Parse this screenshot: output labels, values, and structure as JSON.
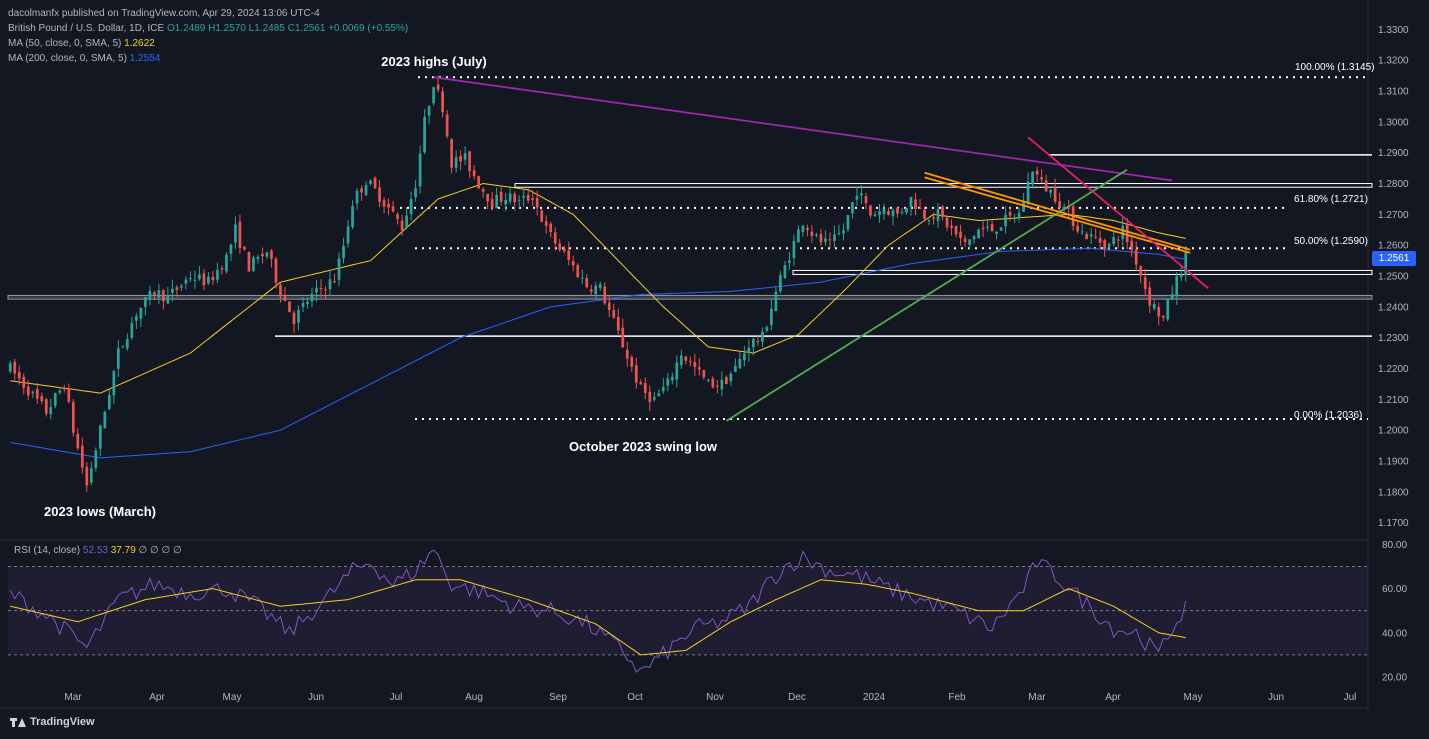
{
  "header": {
    "published": "dacolmanfx published on TradingView.com, Apr 29, 2024 13:06 UTC-4",
    "symbol": "British Pound / U.S. Dollar, 1D, ICE",
    "ohlc": "O1.2489  H1.2570  L1.2485  C1.2561  +0.0069 (+0.55%)",
    "ma50_label": "MA (50, close, 0, SMA, 5)",
    "ma50_value": "1.2622",
    "ma200_label": "MA (200, close, 0, SMA, 5)",
    "ma200_value": "1.2554"
  },
  "rsi_header": {
    "label": "RSI (14, close)",
    "value": "52.53",
    "ma_value": "37.79",
    "extras": "∅  ∅  ∅  ∅"
  },
  "last_price": "1.2561",
  "brand": "TradingView",
  "colors": {
    "background": "#131722",
    "up": "#26a69a",
    "down": "#ef5350",
    "ma50": "#f5d020",
    "ma200": "#2962ff",
    "rsi": "#7e57c2",
    "purple_trend": "#9c27b0",
    "green_trend": "#4caf50",
    "orange_trend": "#ff9800",
    "pink_trend": "#e91e63"
  },
  "chart_data": {
    "type": "candlestick",
    "price_axis": {
      "ticks": [
        "1.3300",
        "1.3200",
        "1.3100",
        "1.3000",
        "1.2900",
        "1.2800",
        "1.2700",
        "1.2600",
        "1.2500",
        "1.2400",
        "1.2300",
        "1.2200",
        "1.2100",
        "1.2000",
        "1.1900",
        "1.1800",
        "1.1700"
      ],
      "ylim": [
        1.165,
        1.335
      ]
    },
    "rsi_axis": {
      "ticks": [
        "80.00",
        "60.00",
        "40.00",
        "20.00"
      ],
      "ylim": [
        15,
        82
      ],
      "bands": [
        30,
        70
      ]
    },
    "x_labels": [
      "Mar",
      "Apr",
      "May",
      "Jun",
      "Jul",
      "Aug",
      "Sep",
      "Oct",
      "Nov",
      "Dec",
      "2024",
      "Feb",
      "Mar",
      "Apr",
      "May",
      "Jun",
      "Jul"
    ],
    "annotations": {
      "highs": "2023 highs (July)",
      "lows": "2023 lows (March)",
      "swing_low": "October 2023 swing low",
      "fib_100": "100.00% (1.3145)",
      "fib_618": "61.80% (1.2721)",
      "fib_50": "50.00% (1.2590)",
      "fib_0": "0.00% (1.2036)"
    },
    "levels": {
      "fib_100": 1.3145,
      "fib_618": 1.2721,
      "fib_50": 1.259,
      "fib_0": 1.2036,
      "res_top": 1.2893,
      "zone_top_high": 1.28,
      "zone_top_low": 1.2788,
      "zone_mid_high": 1.2518,
      "zone_mid_low": 1.2505,
      "zone_low_high": 1.2437,
      "zone_low_low": 1.2425,
      "support": 1.2305
    },
    "path": [
      [
        0,
        1.22
      ],
      [
        8,
        1.206
      ],
      [
        12,
        1.215
      ],
      [
        14,
        1.2
      ],
      [
        17,
        1.182
      ],
      [
        20,
        1.2
      ],
      [
        24,
        1.225
      ],
      [
        28,
        1.238
      ],
      [
        32,
        1.245
      ],
      [
        35,
        1.243
      ],
      [
        40,
        1.25
      ],
      [
        44,
        1.248
      ],
      [
        48,
        1.256
      ],
      [
        50,
        1.265
      ],
      [
        53,
        1.253
      ],
      [
        57,
        1.258
      ],
      [
        60,
        1.245
      ],
      [
        63,
        1.236
      ],
      [
        66,
        1.242
      ],
      [
        69,
        1.246
      ],
      [
        72,
        1.249
      ],
      [
        74,
        1.26
      ],
      [
        76,
        1.274
      ],
      [
        79,
        1.281
      ],
      [
        82,
        1.276
      ],
      [
        85,
        1.27
      ],
      [
        87,
        1.266
      ],
      [
        90,
        1.28
      ],
      [
        92,
        1.3
      ],
      [
        94,
        1.313
      ],
      [
        96,
        1.305
      ],
      [
        98,
        1.287
      ],
      [
        101,
        1.288
      ],
      [
        104,
        1.28
      ],
      [
        107,
        1.274
      ],
      [
        110,
        1.276
      ],
      [
        113,
        1.274
      ],
      [
        116,
        1.276
      ],
      [
        119,
        1.265
      ],
      [
        122,
        1.259
      ],
      [
        125,
        1.253
      ],
      [
        128,
        1.247
      ],
      [
        131,
        1.246
      ],
      [
        134,
        1.235
      ],
      [
        137,
        1.224
      ],
      [
        140,
        1.213
      ],
      [
        143,
        1.21
      ],
      [
        146,
        1.215
      ],
      [
        149,
        1.225
      ],
      [
        152,
        1.22
      ],
      [
        155,
        1.215
      ],
      [
        158,
        1.215
      ],
      [
        161,
        1.22
      ],
      [
        164,
        1.228
      ],
      [
        167,
        1.23
      ],
      [
        170,
        1.245
      ],
      [
        173,
        1.257
      ],
      [
        176,
        1.268
      ],
      [
        179,
        1.262
      ],
      [
        182,
        1.26
      ],
      [
        185,
        1.265
      ],
      [
        188,
        1.278
      ],
      [
        191,
        1.27
      ],
      [
        194,
        1.272
      ],
      [
        197,
        1.27
      ],
      [
        200,
        1.275
      ],
      [
        203,
        1.27
      ],
      [
        206,
        1.27
      ],
      [
        209,
        1.265
      ],
      [
        212,
        1.26
      ],
      [
        215,
        1.265
      ],
      [
        218,
        1.265
      ],
      [
        221,
        1.268
      ],
      [
        224,
        1.27
      ],
      [
        227,
        1.285
      ],
      [
        229,
        1.28
      ],
      [
        232,
        1.276
      ],
      [
        235,
        1.27
      ],
      [
        238,
        1.264
      ],
      [
        241,
        1.262
      ],
      [
        244,
        1.26
      ],
      [
        247,
        1.265
      ],
      [
        250,
        1.255
      ],
      [
        253,
        1.242
      ],
      [
        256,
        1.236
      ],
      [
        258,
        1.245
      ],
      [
        261,
        1.2561
      ]
    ],
    "ma50_path": [
      [
        0,
        1.216
      ],
      [
        20,
        1.212
      ],
      [
        40,
        1.225
      ],
      [
        60,
        1.248
      ],
      [
        80,
        1.255
      ],
      [
        95,
        1.275
      ],
      [
        105,
        1.28
      ],
      [
        115,
        1.278
      ],
      [
        125,
        1.27
      ],
      [
        135,
        1.255
      ],
      [
        145,
        1.24
      ],
      [
        155,
        1.227
      ],
      [
        165,
        1.225
      ],
      [
        175,
        1.231
      ],
      [
        185,
        1.245
      ],
      [
        195,
        1.26
      ],
      [
        205,
        1.27
      ],
      [
        215,
        1.268
      ],
      [
        225,
        1.269
      ],
      [
        235,
        1.27
      ],
      [
        245,
        1.268
      ],
      [
        255,
        1.264
      ],
      [
        261,
        1.2622
      ]
    ],
    "ma200_path": [
      [
        0,
        1.196
      ],
      [
        20,
        1.191
      ],
      [
        40,
        1.193
      ],
      [
        60,
        1.2
      ],
      [
        80,
        1.215
      ],
      [
        100,
        1.23
      ],
      [
        120,
        1.24
      ],
      [
        140,
        1.244
      ],
      [
        160,
        1.245
      ],
      [
        180,
        1.248
      ],
      [
        200,
        1.254
      ],
      [
        220,
        1.258
      ],
      [
        240,
        1.259
      ],
      [
        255,
        1.257
      ],
      [
        261,
        1.2554
      ]
    ],
    "rsi_path": [
      [
        0,
        58
      ],
      [
        10,
        45
      ],
      [
        17,
        33
      ],
      [
        24,
        55
      ],
      [
        32,
        62
      ],
      [
        40,
        58
      ],
      [
        48,
        60
      ],
      [
        55,
        52
      ],
      [
        62,
        40
      ],
      [
        70,
        55
      ],
      [
        76,
        68
      ],
      [
        80,
        72
      ],
      [
        85,
        62
      ],
      [
        90,
        68
      ],
      [
        94,
        78
      ],
      [
        98,
        62
      ],
      [
        105,
        58
      ],
      [
        112,
        52
      ],
      [
        120,
        50
      ],
      [
        128,
        44
      ],
      [
        136,
        32
      ],
      [
        140,
        22
      ],
      [
        145,
        30
      ],
      [
        152,
        42
      ],
      [
        158,
        45
      ],
      [
        164,
        52
      ],
      [
        168,
        62
      ],
      [
        172,
        70
      ],
      [
        176,
        74
      ],
      [
        182,
        68
      ],
      [
        188,
        66
      ],
      [
        195,
        60
      ],
      [
        202,
        55
      ],
      [
        210,
        50
      ],
      [
        218,
        42
      ],
      [
        225,
        60
      ],
      [
        228,
        72
      ],
      [
        232,
        66
      ],
      [
        238,
        55
      ],
      [
        245,
        42
      ],
      [
        250,
        40
      ],
      [
        255,
        30
      ],
      [
        258,
        42
      ],
      [
        261,
        52.53
      ]
    ],
    "rsi_ma_path": [
      [
        0,
        52
      ],
      [
        15,
        45
      ],
      [
        30,
        55
      ],
      [
        45,
        60
      ],
      [
        60,
        52
      ],
      [
        75,
        55
      ],
      [
        90,
        64
      ],
      [
        100,
        64
      ],
      [
        115,
        55
      ],
      [
        130,
        44
      ],
      [
        140,
        30
      ],
      [
        150,
        32
      ],
      [
        160,
        45
      ],
      [
        170,
        55
      ],
      [
        180,
        64
      ],
      [
        190,
        62
      ],
      [
        200,
        58
      ],
      [
        215,
        50
      ],
      [
        225,
        50
      ],
      [
        235,
        60
      ],
      [
        245,
        52
      ],
      [
        255,
        40
      ],
      [
        261,
        37.79
      ]
    ]
  }
}
